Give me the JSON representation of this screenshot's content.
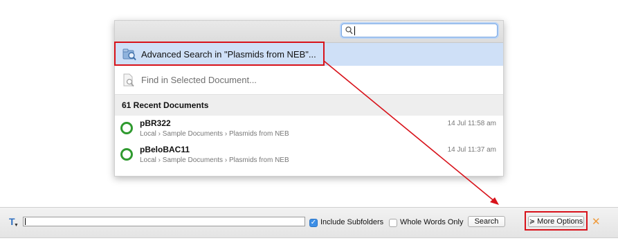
{
  "dropdown": {
    "search_value": "",
    "advanced_search_label": "Advanced Search in \"Plasmids from NEB\"...",
    "find_in_document_label": "Find in Selected Document...",
    "recent_header": "61 Recent Documents",
    "documents": [
      {
        "name": "pBR322",
        "path": "Local › Sample Documents › Plasmids from NEB",
        "time": "14 Jul 11:58 am"
      },
      {
        "name": "pBeloBAC11",
        "path": "Local › Sample Documents › Plasmids from NEB",
        "time": "14 Jul 11:37 am"
      }
    ]
  },
  "search_bar": {
    "query_value": "",
    "include_subfolders_label": "Include Subfolders",
    "include_subfolders_checked": true,
    "whole_words_label": "Whole Words Only",
    "whole_words_checked": false,
    "search_button_label": "Search",
    "more_options_label": "More Options"
  },
  "colors": {
    "highlight_row": "#cfe0f7",
    "annotation_red": "#d8121a",
    "document_ring": "#2f9a2f",
    "close_icon": "#ef9a3a",
    "checkbox_accent": "#3d8fe6"
  },
  "icons": {
    "search": "magnifier-icon",
    "advanced_search": "advanced-search-folder-icon",
    "find_in_document": "document-search-icon",
    "document": "circular-sequence-icon",
    "text_type": "text-type-icon",
    "more_options": "double-chevron-down-icon",
    "close": "close-icon"
  }
}
